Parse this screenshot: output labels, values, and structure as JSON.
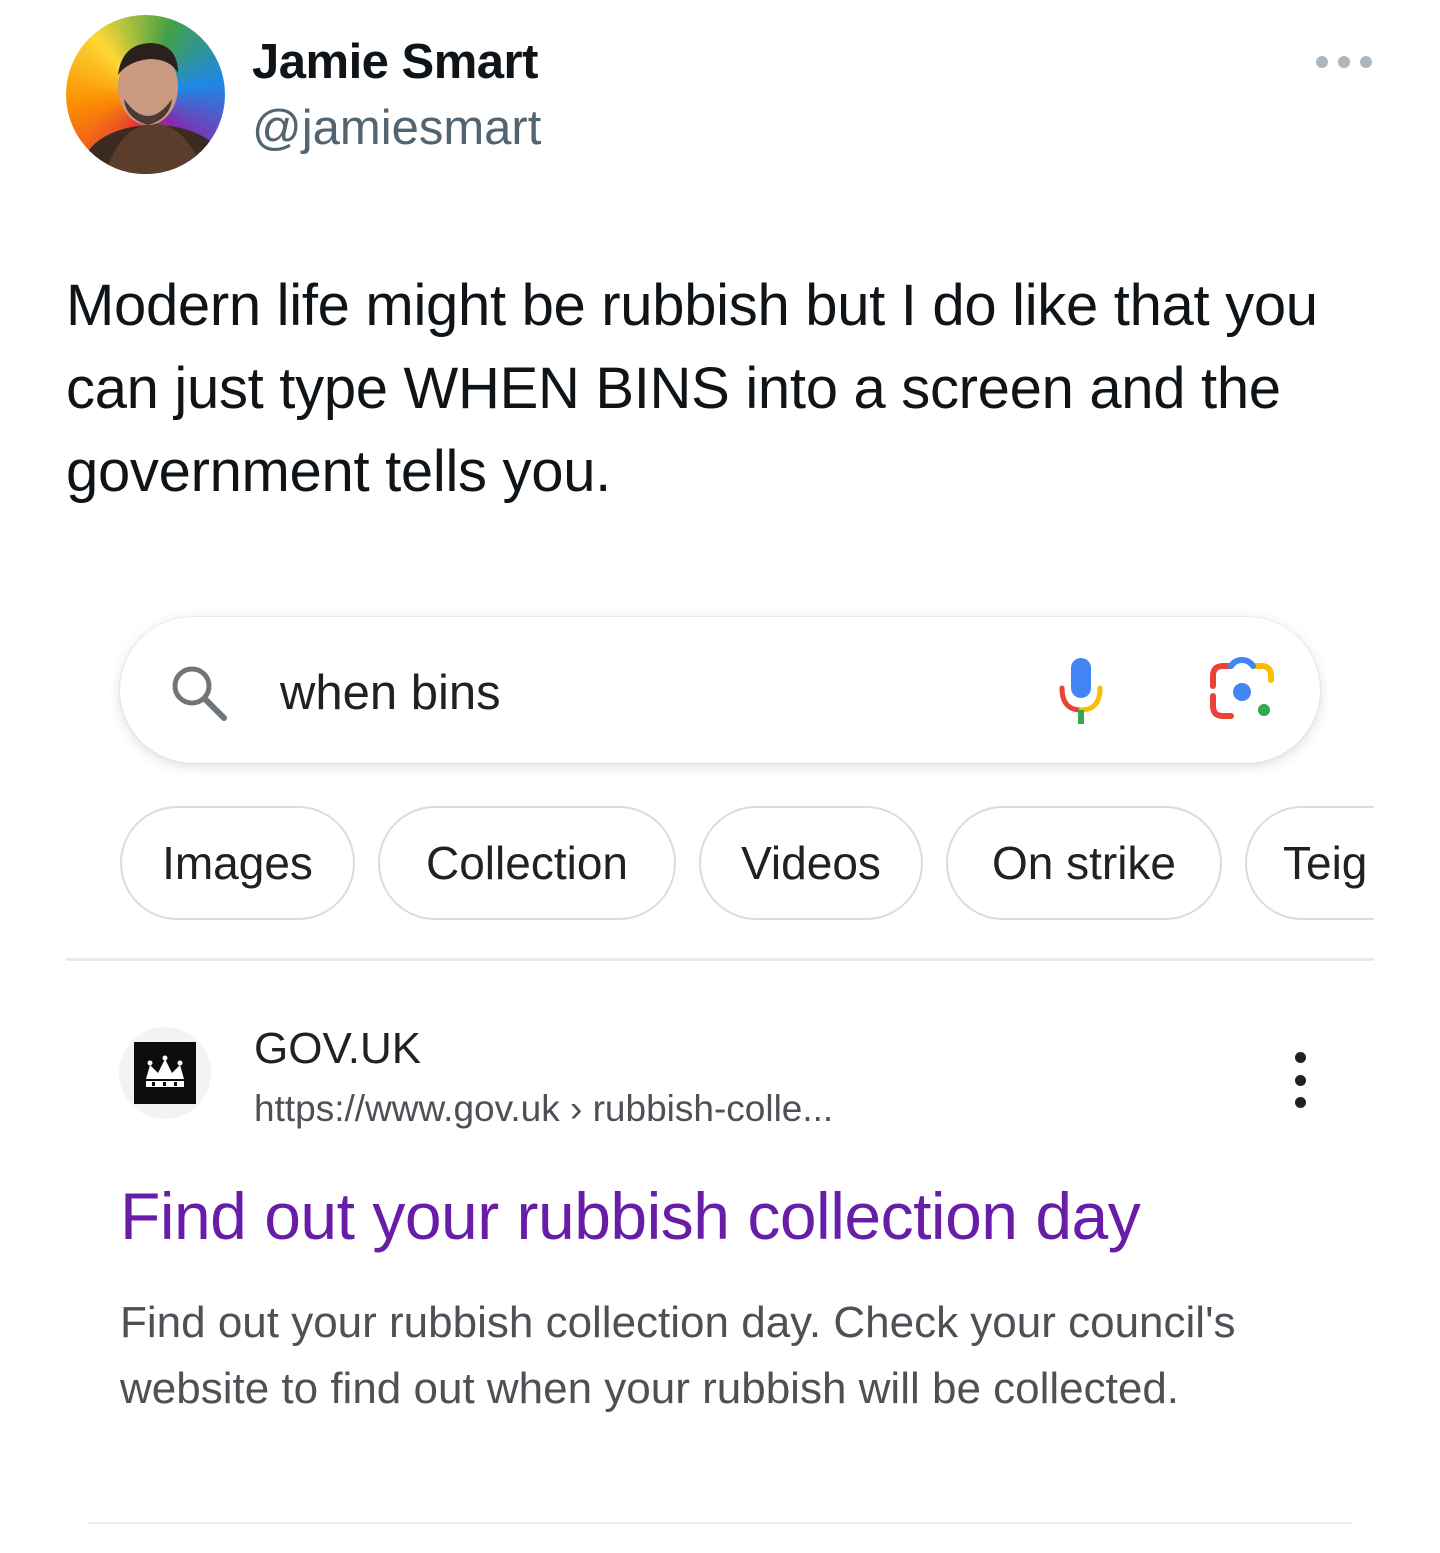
{
  "tweet": {
    "author_name": "Jamie Smart",
    "author_handle": "@jamiesmart",
    "text": "Modern life might be rubbish but I do like that you can just type WHEN BINS into a screen and the government tells you."
  },
  "google": {
    "search": {
      "query": "when bins"
    },
    "chips": [
      "Images",
      "Collection",
      "Videos",
      "On strike",
      "Teig"
    ],
    "result": {
      "site_name": "GOV.UK",
      "url": "https://www.gov.uk › rubbish-colle...",
      "title": "Find out your rubbish collection day",
      "snippet": "Find out your rubbish collection day. Check your council's website to find out when your rubbish will be collected."
    }
  },
  "colors": {
    "visited_link": "#681da8",
    "handle_gray": "#536471",
    "snippet_gray": "#4d5156"
  },
  "icons": {
    "search": "magnifier-icon",
    "voice": "microphone-icon",
    "lens": "google-lens-icon",
    "more": "ellipsis-icon",
    "favicon": "crown-icon"
  }
}
